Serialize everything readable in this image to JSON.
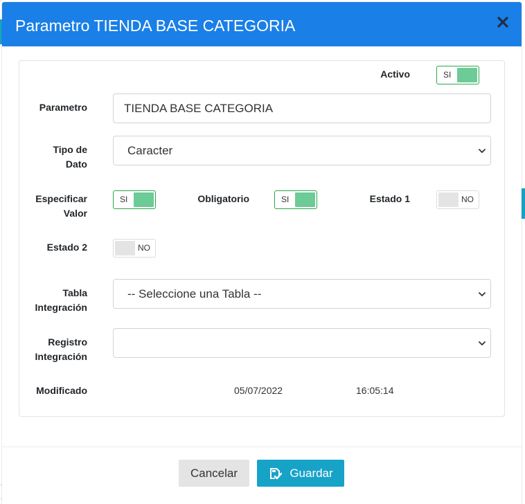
{
  "modal": {
    "title": "Parametro TIENDA BASE CATEGORIA",
    "close_icon": "close-icon"
  },
  "form": {
    "activo": {
      "label": "Activo",
      "state": "on",
      "text": "SI"
    },
    "parametro": {
      "label": "Parametro",
      "value": "TIENDA BASE CATEGORIA"
    },
    "tipo_dato": {
      "label_line1": "Tipo de",
      "label_line2": "Dato",
      "selected": "Caracter"
    },
    "especificar_valor": {
      "label_line1": "Especificar",
      "label_line2": "Valor",
      "state": "on",
      "text": "SI"
    },
    "obligatorio": {
      "label": "Obligatorio",
      "state": "on",
      "text": "SI"
    },
    "estado1": {
      "label": "Estado 1",
      "state": "off",
      "text": "NO"
    },
    "estado2": {
      "label": "Estado 2",
      "state": "off",
      "text": "NO"
    },
    "tabla_integracion": {
      "label_line1": "Tabla",
      "label_line2": "Integración",
      "selected": "-- Seleccione una Tabla --"
    },
    "registro_integracion": {
      "label_line1": "Registro",
      "label_line2": "Integración",
      "selected": ""
    },
    "modificado": {
      "label": "Modificado",
      "date": "05/07/2022",
      "time": "16:05:14"
    }
  },
  "footer": {
    "cancel_label": "Cancelar",
    "save_label": "Guardar",
    "save_icon": "save-icon"
  },
  "colors": {
    "header": "#1a7fe6",
    "toggle_on": "#6ccb97",
    "save_button": "#17a2c8",
    "cancel_button": "#e4e4e4"
  }
}
